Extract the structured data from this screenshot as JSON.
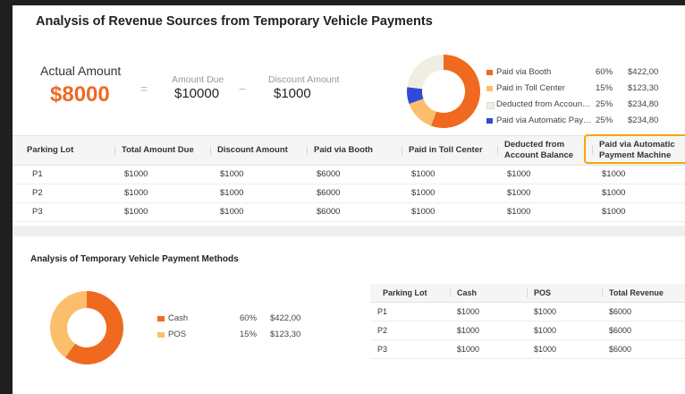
{
  "revenue": {
    "title": "Analysis of Revenue Sources from Temporary Vehicle Payments",
    "actual_label": "Actual Amount",
    "actual_value": "$8000",
    "equals_sign": "=",
    "minus_sign": "−",
    "amount_due_label": "Amount Due",
    "amount_due_value": "$10000",
    "discount_label": "Discount Amount",
    "discount_value": "$1000",
    "legend": [
      {
        "name": "Paid via Booth",
        "pct": "60%",
        "amount": "$422,00",
        "color": "#ef6a1f"
      },
      {
        "name": "Paid in Toll Center",
        "pct": "15%",
        "amount": "$123,30",
        "color": "#fbbf6c"
      },
      {
        "name": "Deducted from Account ...",
        "pct": "25%",
        "amount": "$234,80",
        "color": "#f0ede2"
      },
      {
        "name": "Paid via Automatic Payme...",
        "pct": "25%",
        "amount": "$234,80",
        "color": "#2f4bd8"
      }
    ],
    "table": {
      "headers": [
        "Parking Lot",
        "Total Amount Due",
        "Discount Amount",
        "Paid via Booth",
        "Paid in Toll Center",
        "Deducted from Account Balance",
        "Paid via Automatic Payment Machine"
      ],
      "rows": [
        [
          "P1",
          "$1000",
          "$1000",
          "$6000",
          "$1000",
          "$1000",
          "$1000"
        ],
        [
          "P2",
          "$1000",
          "$1000",
          "$6000",
          "$1000",
          "$1000",
          "$1000"
        ],
        [
          "P3",
          "$1000",
          "$1000",
          "$6000",
          "$1000",
          "$1000",
          "$1000"
        ]
      ]
    }
  },
  "methods": {
    "title": "Analysis of Temporary Vehicle Payment Methods",
    "legend": [
      {
        "name": "Cash",
        "pct": "60%",
        "amount": "$422,00",
        "color": "#ef6a1f"
      },
      {
        "name": "POS",
        "pct": "15%",
        "amount": "$123,30",
        "color": "#fbbf6c"
      }
    ],
    "table": {
      "headers": [
        "Parking Lot",
        "Cash",
        "POS",
        "Total Revenue"
      ],
      "rows": [
        [
          "P1",
          "$1000",
          "$1000",
          "$6000"
        ],
        [
          "P2",
          "$1000",
          "$1000",
          "$6000"
        ],
        [
          "P3",
          "$1000",
          "$1000",
          "$6000"
        ]
      ]
    }
  },
  "colors": {
    "accent": "#ee6a24",
    "highlight": "#f7a600"
  }
}
